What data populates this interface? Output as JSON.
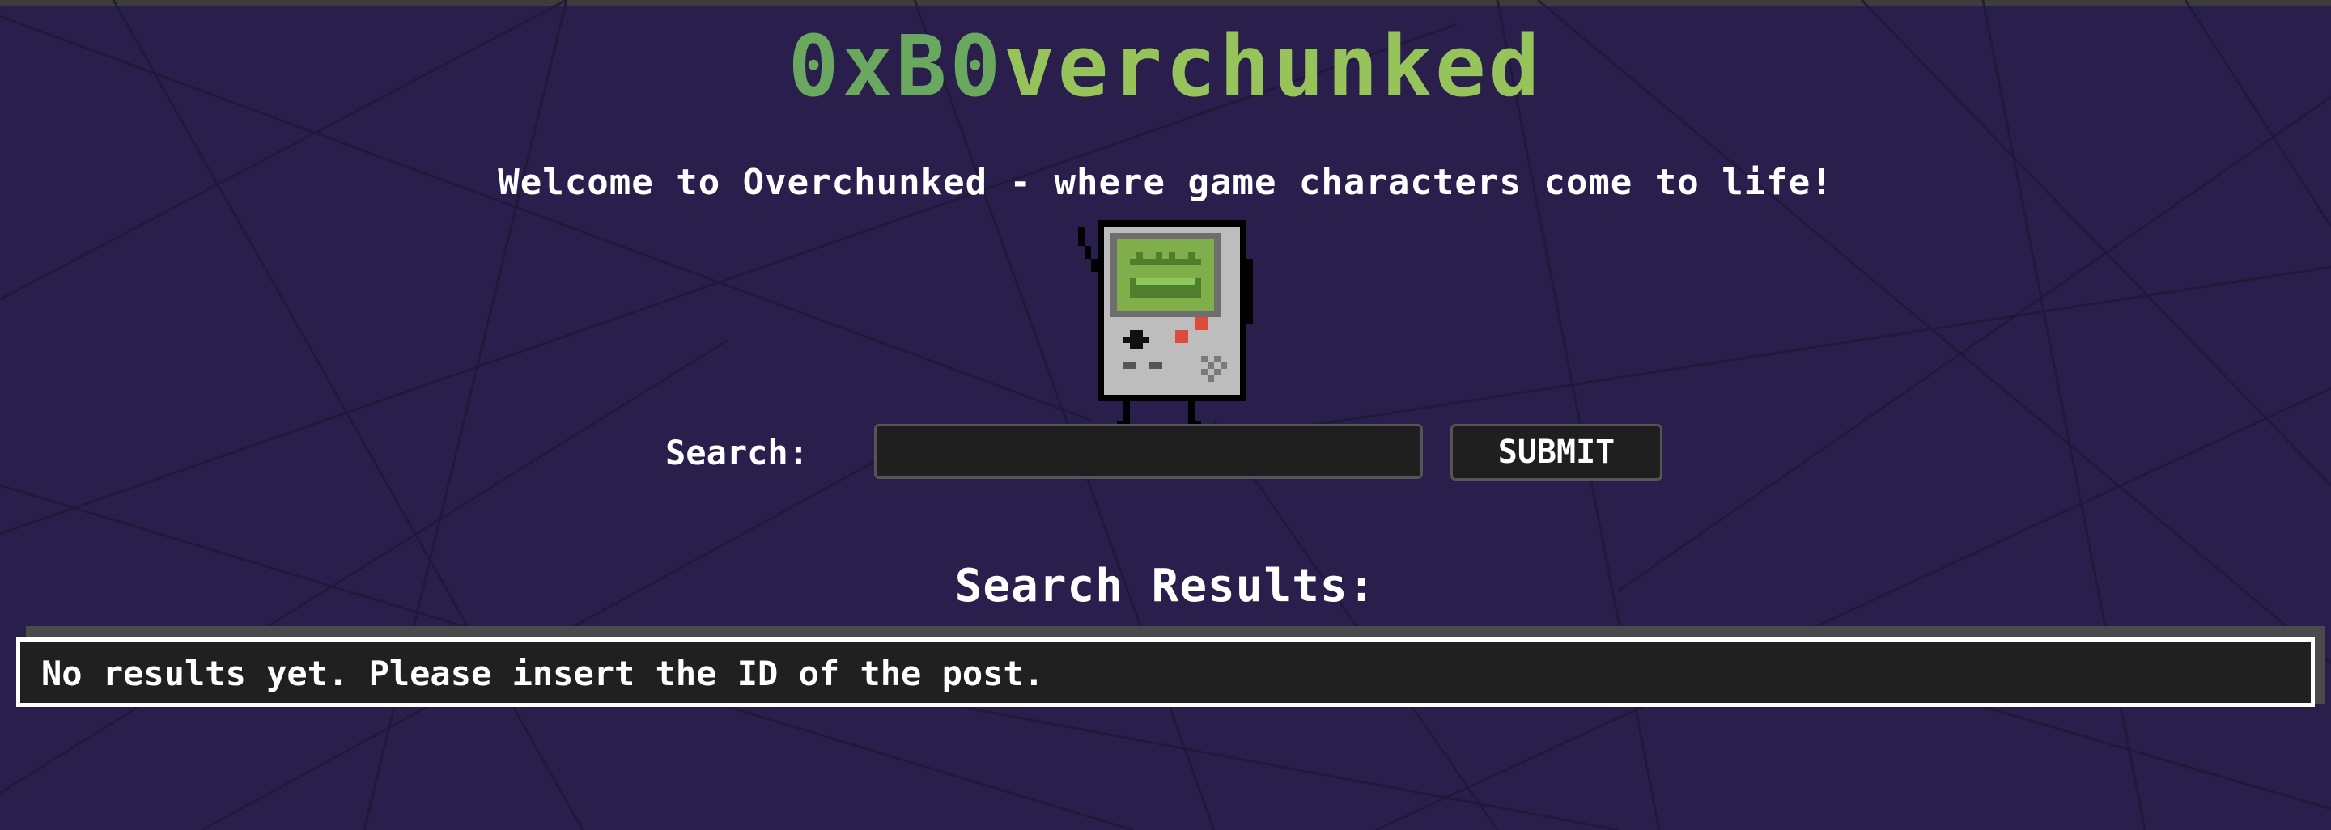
{
  "header": {
    "title_part1": "0xB0",
    "title_part2": "verchunked",
    "tagline": "Welcome to Overchunked - where game characters come to life!"
  },
  "mascot": {
    "icon": "gameboy-mascot-icon"
  },
  "search": {
    "label": "Search:",
    "value": "",
    "placeholder": "",
    "submit_label": "SUBMIT"
  },
  "results": {
    "heading": "Search Results:",
    "message": "No results yet. Please insert the ID of the post."
  },
  "colors": {
    "background": "#2a1f4c",
    "title_dark_green": "#6aa860",
    "title_light_green": "#96c45a",
    "panel": "#1f1f1f",
    "border_white": "#ffffff"
  }
}
